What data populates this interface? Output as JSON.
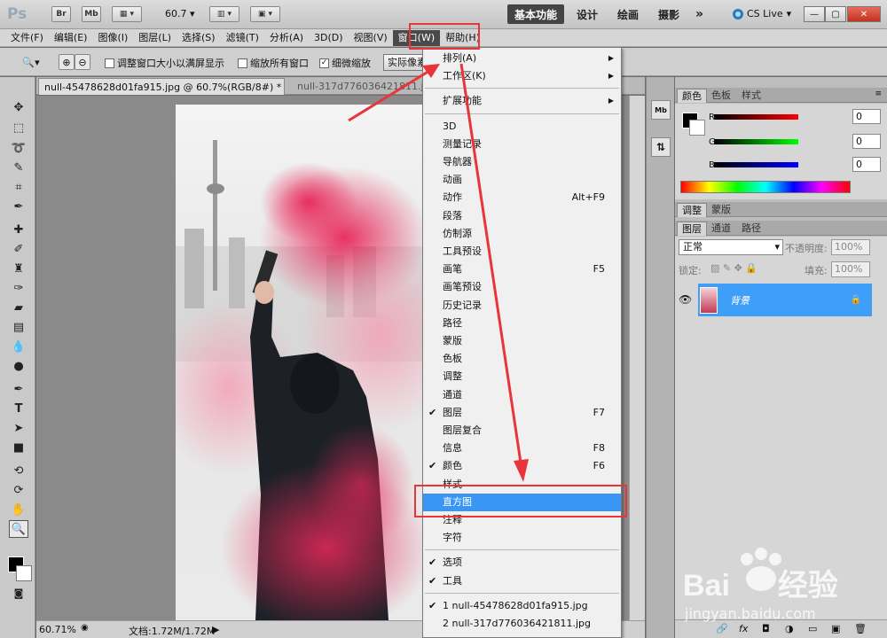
{
  "appbar": {
    "br_label": "Br",
    "mb_label": "Mb",
    "zoom": "60.7",
    "workspaces": [
      "基本功能",
      "设计",
      "绘画",
      "摄影"
    ],
    "more": "»",
    "cslive": "CS Live"
  },
  "menubar": [
    "文件(F)",
    "编辑(E)",
    "图像(I)",
    "图层(L)",
    "选择(S)",
    "滤镜(T)",
    "分析(A)",
    "3D(D)",
    "视图(V)",
    "窗口(W)",
    "帮助(H)"
  ],
  "options": {
    "check1": "调整窗口大小以满屏显示",
    "check2": "缩放所有窗口",
    "check3": "细微缩放",
    "button": "实际像素"
  },
  "tabs": {
    "active": "null-45478628d01fa915.jpg @ 60.7%(RGB/8#) *",
    "inactive": "null-317d776036421811.jpg"
  },
  "status": {
    "zoom": "60.71%",
    "doc": "文档:1.72M/1.72M"
  },
  "color_panel": {
    "tabs": [
      "颜色",
      "色板",
      "样式"
    ],
    "r_label": "R",
    "g_label": "G",
    "b_label": "B",
    "r": "0",
    "g": "0",
    "b": "0"
  },
  "adjust_panel": {
    "tabs": [
      "调整",
      "蒙版"
    ]
  },
  "layers_panel": {
    "tabs": [
      "图层",
      "通道",
      "路径"
    ],
    "mode": "正常",
    "opacity_label": "不透明度:",
    "opacity": "100%",
    "lock_label": "锁定:",
    "fill_label": "填充:",
    "fill": "100%",
    "layer_name": "背景"
  },
  "window_menu": {
    "items": [
      {
        "label": "排列(A)",
        "submenu": true
      },
      {
        "label": "工作区(K)",
        "submenu": true
      },
      {
        "sep": true
      },
      {
        "label": "扩展功能",
        "submenu": true
      },
      {
        "sep": true
      },
      {
        "label": "3D"
      },
      {
        "label": "测量记录"
      },
      {
        "label": "导航器"
      },
      {
        "label": "动画"
      },
      {
        "label": "动作",
        "shortcut": "Alt+F9"
      },
      {
        "label": "段落"
      },
      {
        "label": "仿制源"
      },
      {
        "label": "工具预设"
      },
      {
        "label": "画笔",
        "shortcut": "F5"
      },
      {
        "label": "画笔预设"
      },
      {
        "label": "历史记录"
      },
      {
        "label": "路径"
      },
      {
        "label": "蒙版"
      },
      {
        "label": "色板"
      },
      {
        "label": "调整"
      },
      {
        "label": "通道"
      },
      {
        "label": "图层",
        "shortcut": "F7",
        "checked": true
      },
      {
        "label": "图层复合"
      },
      {
        "label": "信息",
        "shortcut": "F8"
      },
      {
        "label": "颜色",
        "shortcut": "F6",
        "checked": true
      },
      {
        "label": "样式"
      },
      {
        "label": "直方图",
        "highlighted": true
      },
      {
        "label": "注释"
      },
      {
        "label": "字符"
      },
      {
        "sep": true
      },
      {
        "label": "选项",
        "checked": true
      },
      {
        "label": "工具",
        "checked": true
      },
      {
        "sep": true
      },
      {
        "label": "1 null-45478628d01fa915.jpg",
        "checked": true
      },
      {
        "label": "2 null-317d776036421811.jpg"
      }
    ]
  },
  "watermark": {
    "brand": "Bai",
    "brand2": "经验",
    "url": "jingyan.baidu.com"
  },
  "colors": {
    "accent": "#3a96f5",
    "annotation": "#e8353a"
  }
}
